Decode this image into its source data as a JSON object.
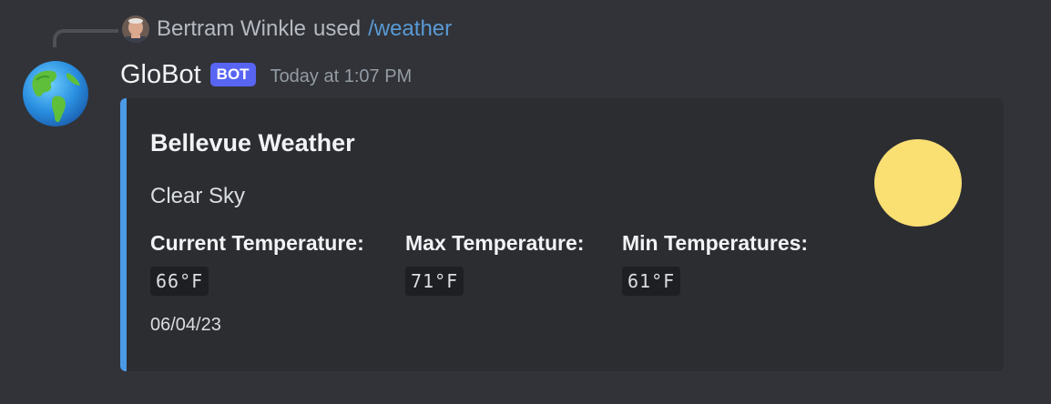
{
  "reply": {
    "user": "Bertram Winkle",
    "verb": "used",
    "command": "/weather"
  },
  "author": {
    "name": "GloBot",
    "tag": "BOT",
    "timestamp": "Today at 1:07 PM",
    "avatar_icon": "globe-americas-icon"
  },
  "embed": {
    "accent_color": "#4a9ae6",
    "title": "Bellevue Weather",
    "description": "Clear Sky",
    "fields": [
      {
        "name": "Current Temperature:",
        "value": "66°F"
      },
      {
        "name": "Max Temperature:",
        "value": "71°F"
      },
      {
        "name": "Min Temperatures:",
        "value": "61°F"
      }
    ],
    "footer": "06/04/23",
    "thumbnail_icon": "sun-icon",
    "thumbnail_color": "#fadf73"
  }
}
